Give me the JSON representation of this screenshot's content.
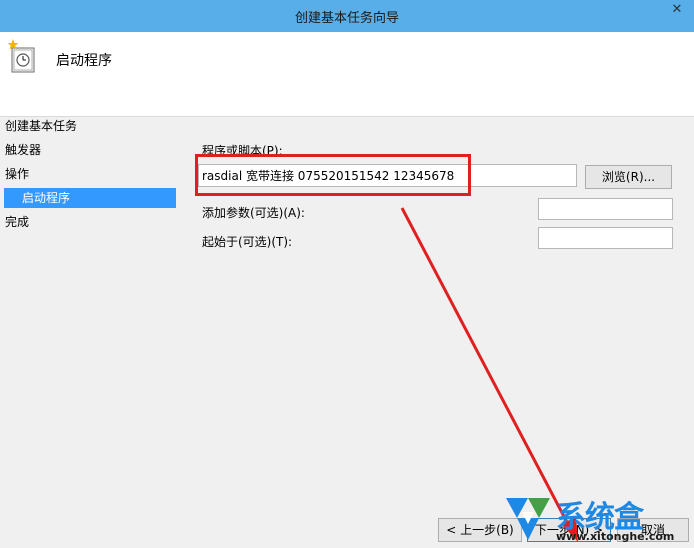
{
  "window": {
    "title": "创建基本任务向导",
    "close_glyph": "✕"
  },
  "header": {
    "title": "启动程序",
    "icon": "task-scheduler-clock-icon"
  },
  "nav": {
    "items": [
      {
        "label": "创建基本任务"
      },
      {
        "label": "触发器"
      },
      {
        "label": "操作"
      },
      {
        "label": "启动程序"
      },
      {
        "label": "完成"
      }
    ]
  },
  "form": {
    "program_label": "程序或脚本(P):",
    "program_value": "rasdial 宽带连接 075520151542 12345678",
    "browse_label": "浏览(R)...",
    "args_label": "添加参数(可选)(A):",
    "args_value": "",
    "start_label": "起始于(可选)(T):",
    "start_value": ""
  },
  "footer": {
    "back_label": "< 上一步(B)",
    "next_label": "下一步(N) >",
    "cancel_label": "取消"
  },
  "watermark": {
    "text": "系统盒",
    "url": "www.xitonghe.com"
  },
  "colors": {
    "titlebar": "#57aee8",
    "selection": "#3399ff",
    "annotation": "#e02020",
    "watermark": "#1e88e5"
  }
}
